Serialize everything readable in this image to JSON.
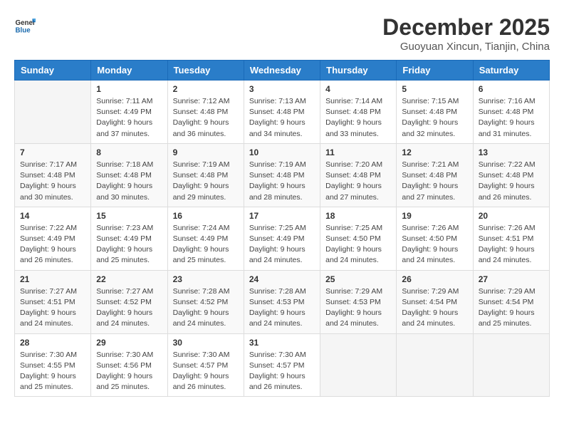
{
  "logo": {
    "general": "General",
    "blue": "Blue"
  },
  "title": "December 2025",
  "location": "Guoyuan Xincun, Tianjin, China",
  "headers": [
    "Sunday",
    "Monday",
    "Tuesday",
    "Wednesday",
    "Thursday",
    "Friday",
    "Saturday"
  ],
  "weeks": [
    [
      {
        "day": "",
        "info": ""
      },
      {
        "day": "1",
        "info": "Sunrise: 7:11 AM\nSunset: 4:49 PM\nDaylight: 9 hours\nand 37 minutes."
      },
      {
        "day": "2",
        "info": "Sunrise: 7:12 AM\nSunset: 4:48 PM\nDaylight: 9 hours\nand 36 minutes."
      },
      {
        "day": "3",
        "info": "Sunrise: 7:13 AM\nSunset: 4:48 PM\nDaylight: 9 hours\nand 34 minutes."
      },
      {
        "day": "4",
        "info": "Sunrise: 7:14 AM\nSunset: 4:48 PM\nDaylight: 9 hours\nand 33 minutes."
      },
      {
        "day": "5",
        "info": "Sunrise: 7:15 AM\nSunset: 4:48 PM\nDaylight: 9 hours\nand 32 minutes."
      },
      {
        "day": "6",
        "info": "Sunrise: 7:16 AM\nSunset: 4:48 PM\nDaylight: 9 hours\nand 31 minutes."
      }
    ],
    [
      {
        "day": "7",
        "info": "Sunrise: 7:17 AM\nSunset: 4:48 PM\nDaylight: 9 hours\nand 30 minutes."
      },
      {
        "day": "8",
        "info": "Sunrise: 7:18 AM\nSunset: 4:48 PM\nDaylight: 9 hours\nand 30 minutes."
      },
      {
        "day": "9",
        "info": "Sunrise: 7:19 AM\nSunset: 4:48 PM\nDaylight: 9 hours\nand 29 minutes."
      },
      {
        "day": "10",
        "info": "Sunrise: 7:19 AM\nSunset: 4:48 PM\nDaylight: 9 hours\nand 28 minutes."
      },
      {
        "day": "11",
        "info": "Sunrise: 7:20 AM\nSunset: 4:48 PM\nDaylight: 9 hours\nand 27 minutes."
      },
      {
        "day": "12",
        "info": "Sunrise: 7:21 AM\nSunset: 4:48 PM\nDaylight: 9 hours\nand 27 minutes."
      },
      {
        "day": "13",
        "info": "Sunrise: 7:22 AM\nSunset: 4:48 PM\nDaylight: 9 hours\nand 26 minutes."
      }
    ],
    [
      {
        "day": "14",
        "info": "Sunrise: 7:22 AM\nSunset: 4:49 PM\nDaylight: 9 hours\nand 26 minutes."
      },
      {
        "day": "15",
        "info": "Sunrise: 7:23 AM\nSunset: 4:49 PM\nDaylight: 9 hours\nand 25 minutes."
      },
      {
        "day": "16",
        "info": "Sunrise: 7:24 AM\nSunset: 4:49 PM\nDaylight: 9 hours\nand 25 minutes."
      },
      {
        "day": "17",
        "info": "Sunrise: 7:25 AM\nSunset: 4:49 PM\nDaylight: 9 hours\nand 24 minutes."
      },
      {
        "day": "18",
        "info": "Sunrise: 7:25 AM\nSunset: 4:50 PM\nDaylight: 9 hours\nand 24 minutes."
      },
      {
        "day": "19",
        "info": "Sunrise: 7:26 AM\nSunset: 4:50 PM\nDaylight: 9 hours\nand 24 minutes."
      },
      {
        "day": "20",
        "info": "Sunrise: 7:26 AM\nSunset: 4:51 PM\nDaylight: 9 hours\nand 24 minutes."
      }
    ],
    [
      {
        "day": "21",
        "info": "Sunrise: 7:27 AM\nSunset: 4:51 PM\nDaylight: 9 hours\nand 24 minutes."
      },
      {
        "day": "22",
        "info": "Sunrise: 7:27 AM\nSunset: 4:52 PM\nDaylight: 9 hours\nand 24 minutes."
      },
      {
        "day": "23",
        "info": "Sunrise: 7:28 AM\nSunset: 4:52 PM\nDaylight: 9 hours\nand 24 minutes."
      },
      {
        "day": "24",
        "info": "Sunrise: 7:28 AM\nSunset: 4:53 PM\nDaylight: 9 hours\nand 24 minutes."
      },
      {
        "day": "25",
        "info": "Sunrise: 7:29 AM\nSunset: 4:53 PM\nDaylight: 9 hours\nand 24 minutes."
      },
      {
        "day": "26",
        "info": "Sunrise: 7:29 AM\nSunset: 4:54 PM\nDaylight: 9 hours\nand 24 minutes."
      },
      {
        "day": "27",
        "info": "Sunrise: 7:29 AM\nSunset: 4:54 PM\nDaylight: 9 hours\nand 25 minutes."
      }
    ],
    [
      {
        "day": "28",
        "info": "Sunrise: 7:30 AM\nSunset: 4:55 PM\nDaylight: 9 hours\nand 25 minutes."
      },
      {
        "day": "29",
        "info": "Sunrise: 7:30 AM\nSunset: 4:56 PM\nDaylight: 9 hours\nand 25 minutes."
      },
      {
        "day": "30",
        "info": "Sunrise: 7:30 AM\nSunset: 4:57 PM\nDaylight: 9 hours\nand 26 minutes."
      },
      {
        "day": "31",
        "info": "Sunrise: 7:30 AM\nSunset: 4:57 PM\nDaylight: 9 hours\nand 26 minutes."
      },
      {
        "day": "",
        "info": ""
      },
      {
        "day": "",
        "info": ""
      },
      {
        "day": "",
        "info": ""
      }
    ]
  ]
}
